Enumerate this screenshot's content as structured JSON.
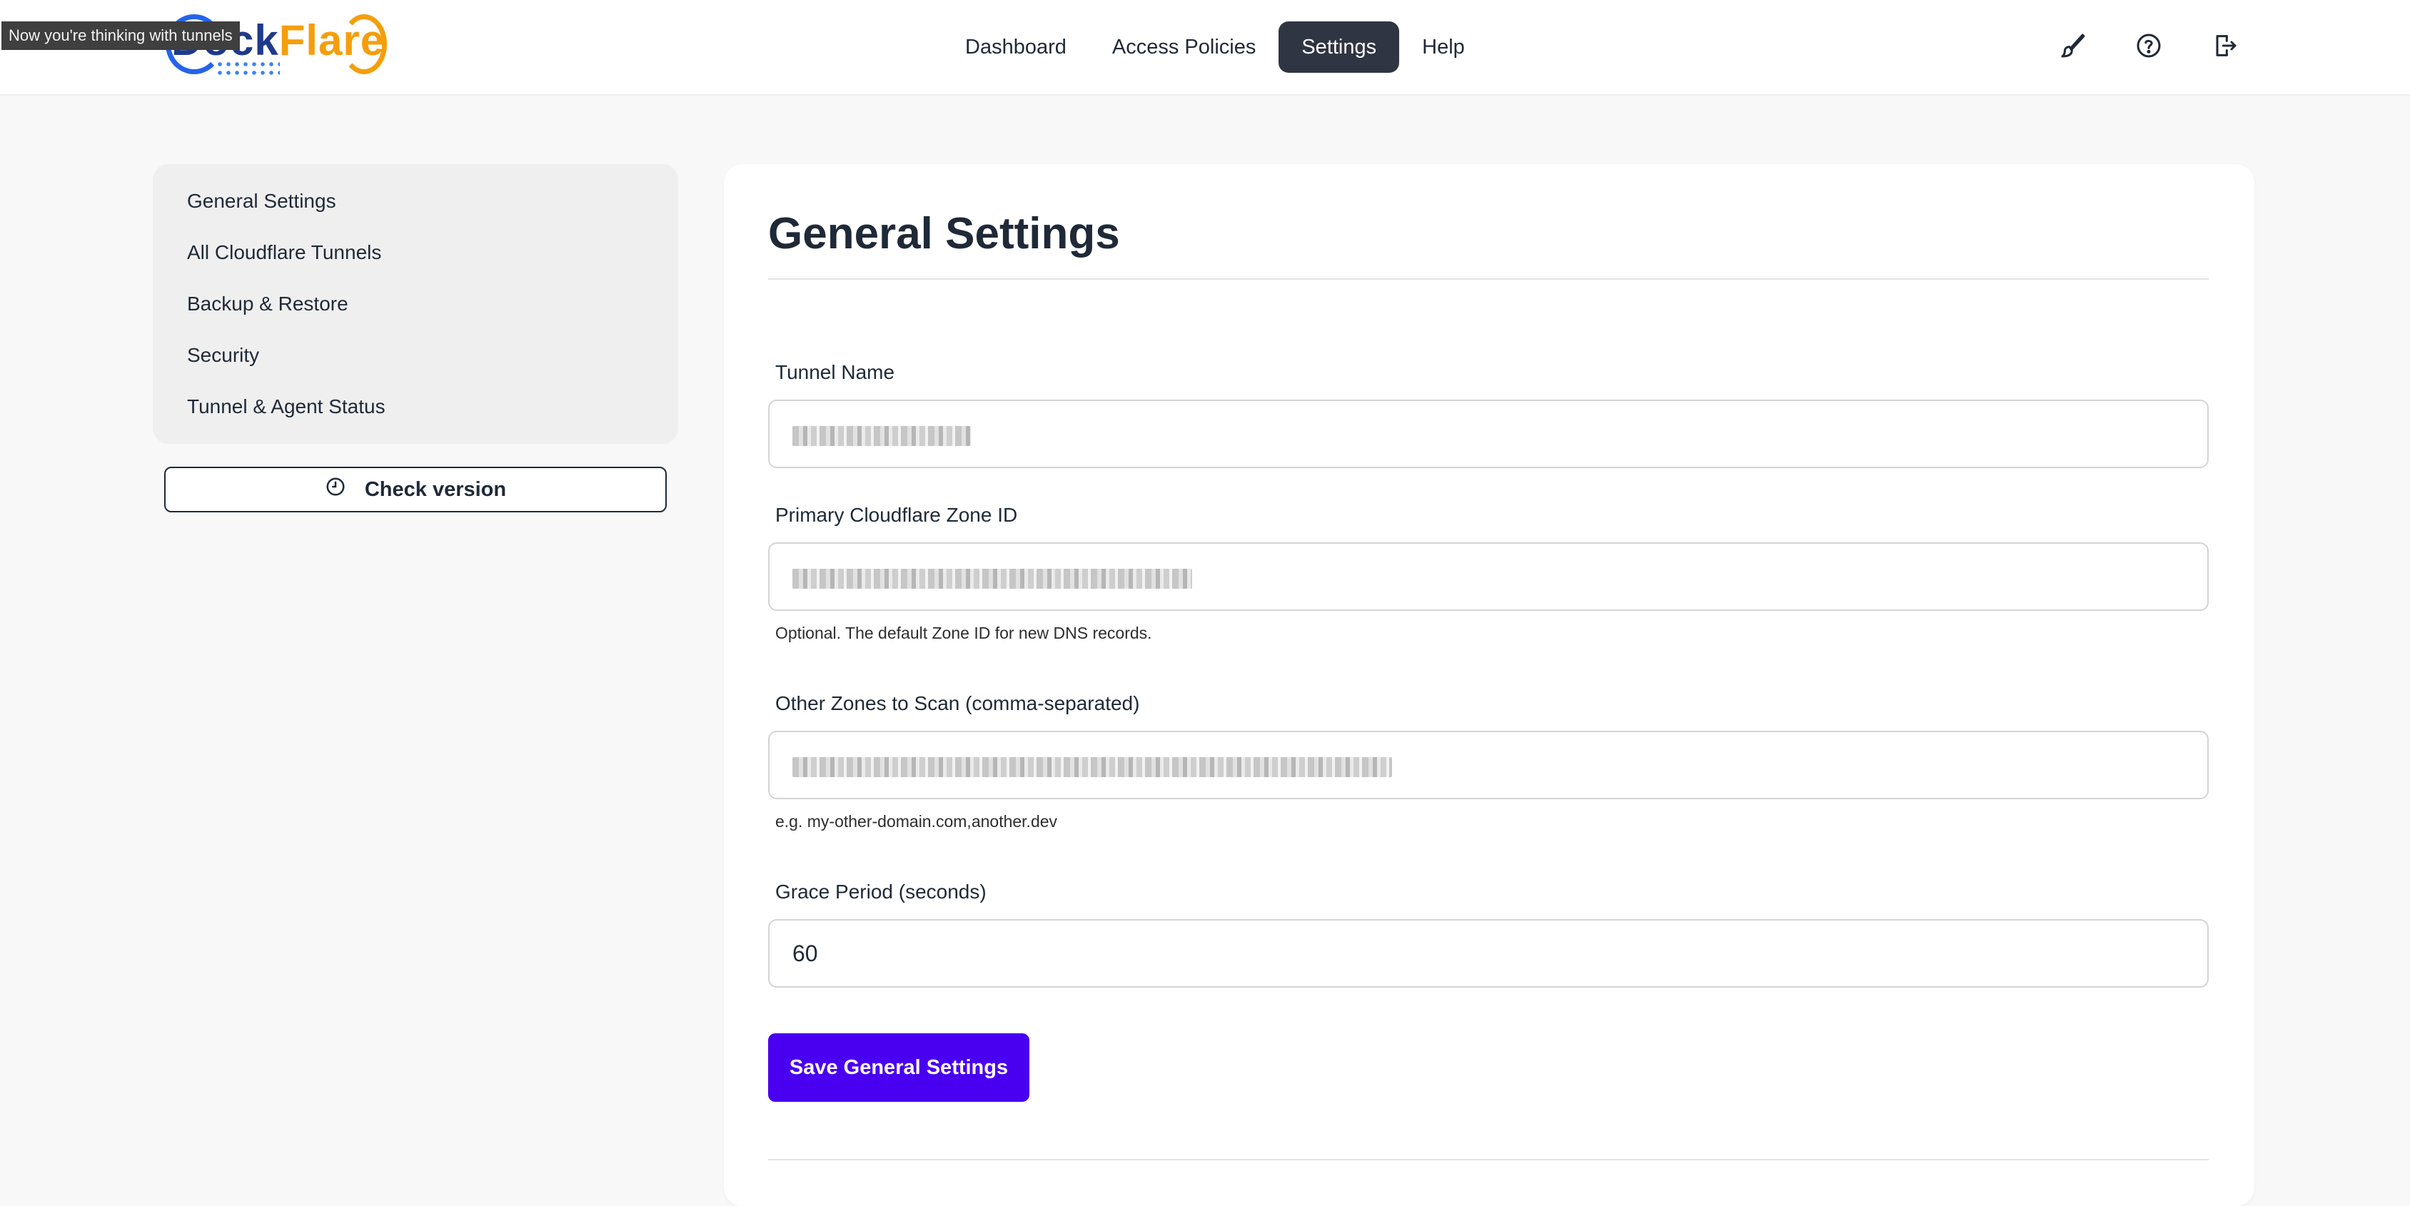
{
  "tooltip": "Now you're thinking with tunnels",
  "logo": {
    "part1": "Dock",
    "part2": "Flare"
  },
  "nav": [
    {
      "label": "Dashboard"
    },
    {
      "label": "Access Policies"
    },
    {
      "label": "Settings",
      "active": true
    },
    {
      "label": "Help"
    }
  ],
  "header_icons": [
    "brush-icon",
    "help-circle-icon",
    "logout-icon"
  ],
  "sidebar": {
    "items": [
      {
        "label": "General Settings"
      },
      {
        "label": "All Cloudflare Tunnels"
      },
      {
        "label": "Backup & Restore"
      },
      {
        "label": "Security"
      },
      {
        "label": "Tunnel & Agent Status"
      }
    ],
    "check_version_label": "Check version",
    "check_version_icon": "clock-icon"
  },
  "main": {
    "title": "General Settings",
    "fields": {
      "tunnel_name": {
        "label": "Tunnel Name"
      },
      "zone_id": {
        "label": "Primary Cloudflare Zone ID",
        "help": "Optional. The default Zone ID for new DNS records."
      },
      "other_zones": {
        "label": "Other Zones to Scan (comma-separated)",
        "help": "e.g. my-other-domain.com,another.dev"
      },
      "grace_period": {
        "label": "Grace Period (seconds)",
        "value": "60"
      }
    },
    "save_label": "Save General Settings"
  },
  "colors": {
    "accent": "#4a00f0",
    "nav_active_bg": "#2f3542",
    "logo_dock": "#1e3a8a",
    "logo_flare": "#f59e0b"
  }
}
